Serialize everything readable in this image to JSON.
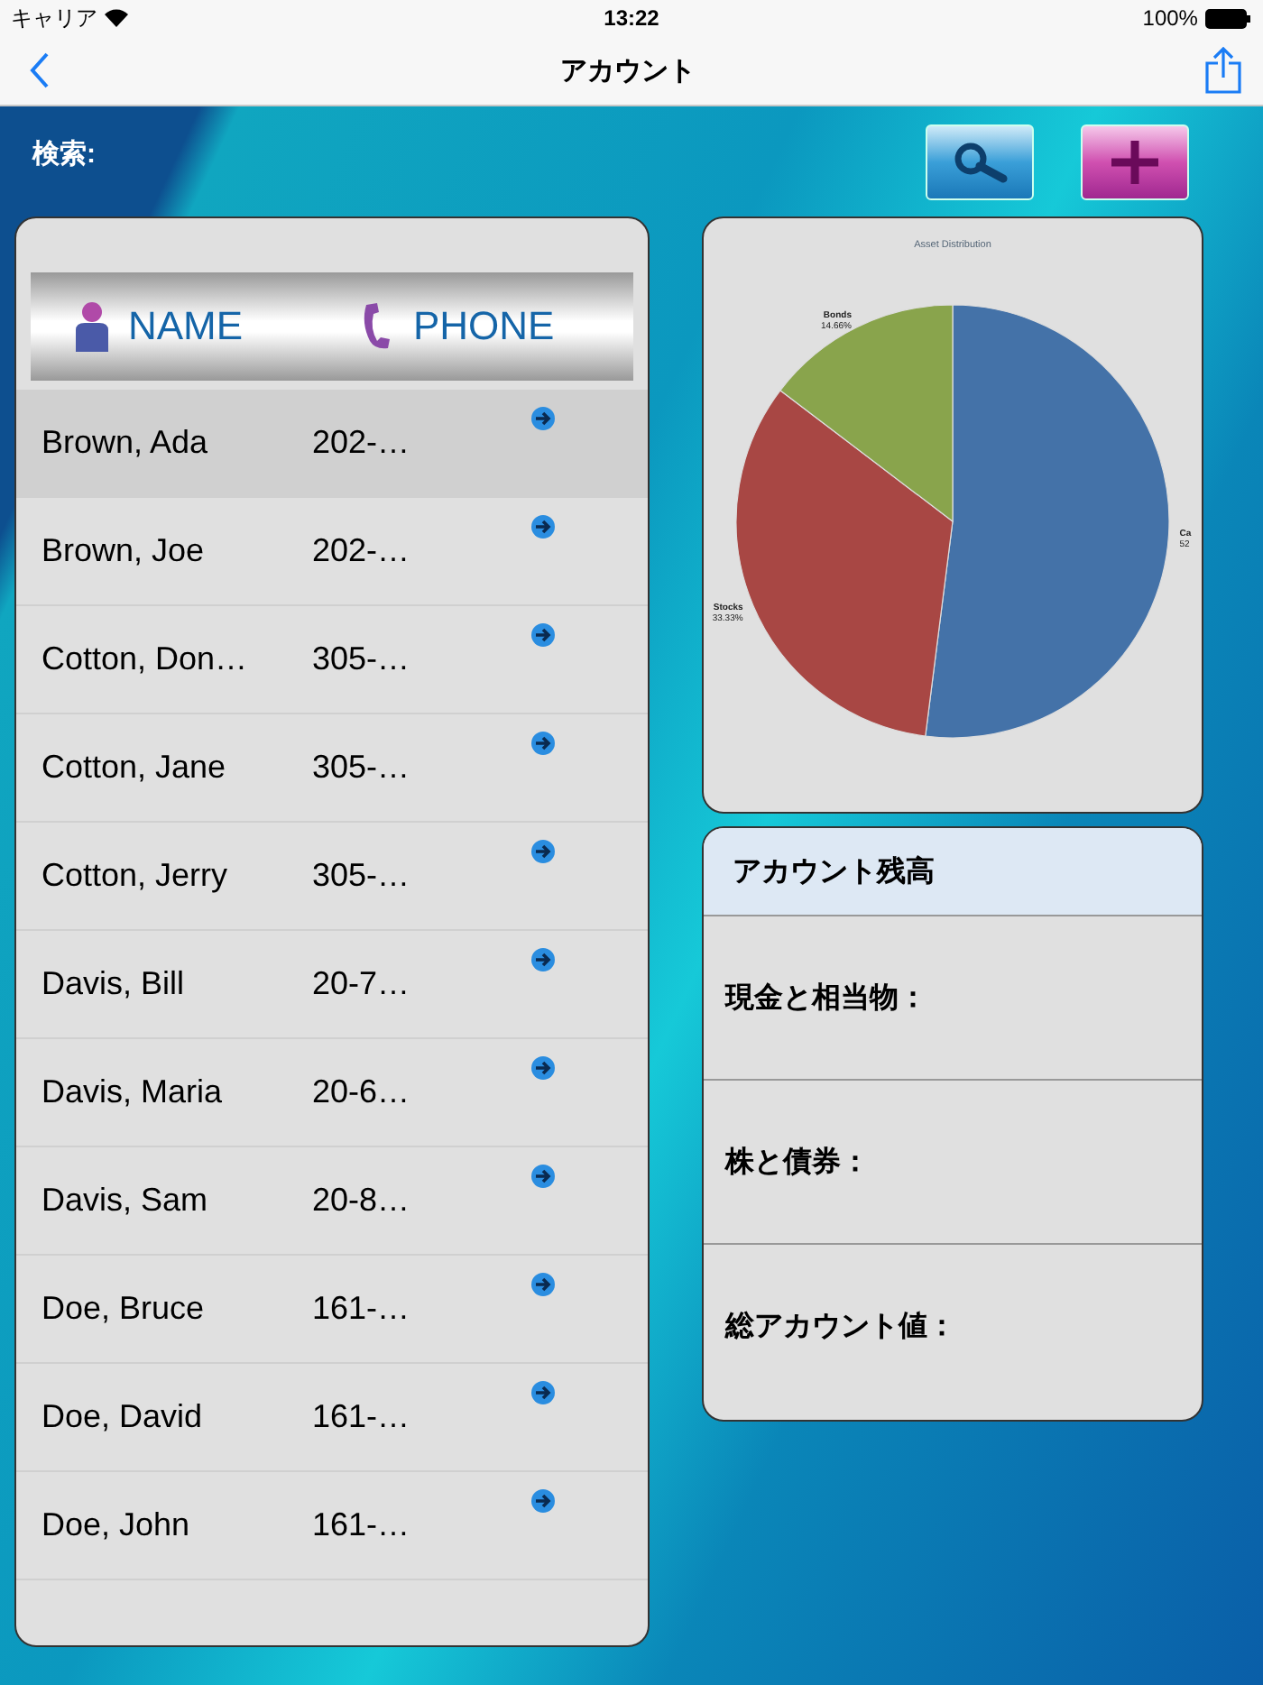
{
  "status_bar": {
    "carrier": "キャリア",
    "time": "13:22",
    "battery": "100%"
  },
  "nav_bar": {
    "title": "アカウント"
  },
  "search": {
    "label": "検索:"
  },
  "list": {
    "columns": [
      "NAME",
      "PHONE"
    ],
    "rows": [
      {
        "name": "Brown, Ada",
        "phone": "202-…",
        "selected": true
      },
      {
        "name": "Brown, Joe",
        "phone": "202-…",
        "selected": false
      },
      {
        "name": "Cotton, Don…",
        "phone": "305-…",
        "selected": false
      },
      {
        "name": "Cotton, Jane",
        "phone": "305-…",
        "selected": false
      },
      {
        "name": "Cotton, Jerry",
        "phone": "305-…",
        "selected": false
      },
      {
        "name": "Davis, Bill",
        "phone": "20-7…",
        "selected": false
      },
      {
        "name": "Davis, Maria",
        "phone": "20-6…",
        "selected": false
      },
      {
        "name": "Davis, Sam",
        "phone": "20-8…",
        "selected": false
      },
      {
        "name": "Doe, Bruce",
        "phone": "161-…",
        "selected": false
      },
      {
        "name": "Doe, David",
        "phone": "161-…",
        "selected": false
      },
      {
        "name": "Doe, John",
        "phone": "161-…",
        "selected": false
      }
    ]
  },
  "chart": {
    "chart_data": {
      "type": "pie",
      "title": "Asset Distribution",
      "categories": [
        "Ca",
        "Stocks",
        "Bonds"
      ],
      "series": [
        {
          "values": [
            52.01,
            33.33,
            14.66
          ]
        }
      ],
      "colors": [
        "#4472a8",
        "#a84744",
        "#89a44c"
      ],
      "value_labels": [
        "52",
        "33.33%",
        "14.66%"
      ]
    }
  },
  "balance": {
    "title": "アカウント残高",
    "rows": [
      "現金と相当物：",
      "株と債券：",
      "総アカウント値："
    ]
  }
}
